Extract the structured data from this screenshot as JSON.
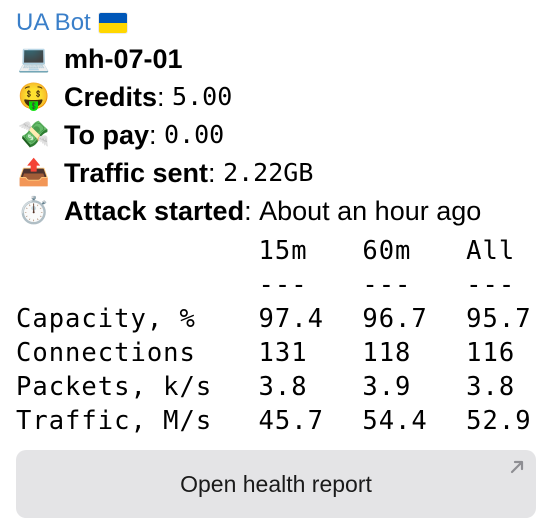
{
  "sender": "UA Bot",
  "lines": {
    "host": {
      "icon": "laptop-icon",
      "glyph": "💻",
      "value": "mh-07-01"
    },
    "credits": {
      "icon": "money-face-icon",
      "glyph": "🤑",
      "label": "Credits",
      "value": "5.00"
    },
    "to_pay": {
      "icon": "money-wings-icon",
      "glyph": "💸",
      "label": "To pay",
      "value": "0.00"
    },
    "traffic_sent": {
      "icon": "outbox-tray-icon",
      "glyph": "📤",
      "label": "Traffic sent",
      "value": "2.22GB"
    },
    "attack_started": {
      "icon": "stopwatch-icon",
      "glyph": "⏱️",
      "label": "Attack started",
      "value": "About an hour ago"
    }
  },
  "stats": {
    "columns": [
      "15m",
      "60m",
      "All"
    ],
    "separator": "---",
    "rows": [
      {
        "label": "Capacity, %",
        "values": [
          "97.4",
          "96.7",
          "95.7"
        ]
      },
      {
        "label": "Connections",
        "values": [
          "131",
          "118",
          "116"
        ]
      },
      {
        "label": "Packets, k/s",
        "values": [
          "3.8",
          "3.9",
          "3.8"
        ]
      },
      {
        "label": "Traffic, M/s",
        "values": [
          "45.7",
          "54.4",
          "52.9"
        ]
      }
    ]
  },
  "button": {
    "label": "Open health report"
  },
  "colors": {
    "sender": "#3a7fc9",
    "button_bg": "#e4e4e6",
    "flag_blue": "#0057b8",
    "flag_yellow": "#ffd700"
  }
}
